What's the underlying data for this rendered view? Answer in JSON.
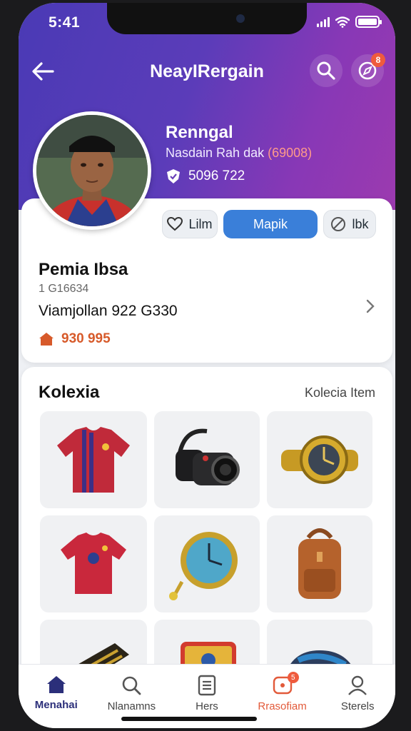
{
  "status": {
    "time": "5:41"
  },
  "nav": {
    "title": "NeayIRergain",
    "notification_count": "8"
  },
  "profile": {
    "name": "Renngal",
    "subtitle": "Nasdain Rah dak",
    "subtitle_code": "(69008)",
    "stat": "5096 722"
  },
  "actions": {
    "like_label": "Lilm",
    "primary_label": "Mapik",
    "block_label": "lbk"
  },
  "info": {
    "name": "Pemia Ibsa",
    "id": "1 G16634",
    "line": "Viamjollan 922 G330",
    "price": "930 995"
  },
  "collection": {
    "title": "Kolexia",
    "link_label": "Kolecia Item",
    "items": [
      "jersey",
      "camera",
      "watch",
      "jersey",
      "clock",
      "backpack",
      "keyboard",
      "tin-box",
      "shoe"
    ]
  },
  "tabs": [
    {
      "label": "Menahai",
      "icon": "home-icon"
    },
    {
      "label": "Nlanamns",
      "icon": "search-icon"
    },
    {
      "label": "Hers",
      "icon": "list-icon"
    },
    {
      "label": "Rrasofiam",
      "icon": "notification-icon",
      "badge": "5"
    },
    {
      "label": "Sterels",
      "icon": "profile-icon"
    }
  ],
  "colors": {
    "header_start": "#4a3ab5",
    "header_end": "#9c3aaf",
    "primary": "#3a7fd9",
    "alert": "#ef5b3d"
  }
}
